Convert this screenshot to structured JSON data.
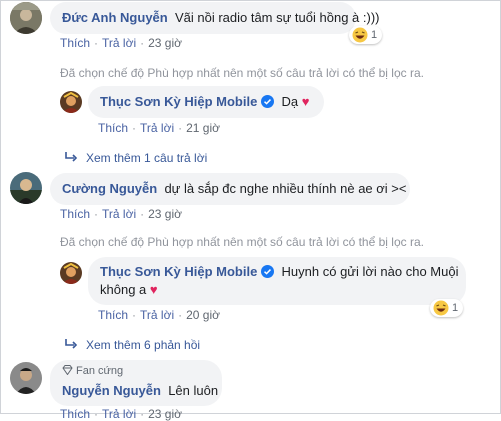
{
  "comments": [
    {
      "author": "Đức Anh Nguyễn",
      "text": "Vãi nồi radio tâm sự tuổi hồng à :)))",
      "actions": {
        "like": "Thích",
        "reply": "Trả lời",
        "time": "23 giờ"
      },
      "reaction": {
        "icon": "haha-emoji-icon",
        "count": "1"
      },
      "notice": "Đã chọn chế độ Phù hợp nhất nên một số câu trả lời có thể bị lọc ra.",
      "reply": {
        "author": "Thục Sơn Kỳ Hiệp Mobile",
        "text": "Dạ",
        "actions": {
          "like": "Thích",
          "reply": "Trả lời",
          "time": "21 giờ"
        }
      },
      "more_replies": "Xem thêm 1 câu trả lời"
    },
    {
      "author": "Cường Nguyễn",
      "text": "dự là sắp đc nghe nhiều thính nè ae ơi ><",
      "actions": {
        "like": "Thích",
        "reply": "Trả lời",
        "time": "23 giờ"
      },
      "notice": "Đã chọn chế độ Phù hợp nhất nên một số câu trả lời có thể bị lọc ra.",
      "reply": {
        "author": "Thục Sơn Kỳ Hiệp Mobile",
        "text_line1": "Huynh có gửi lời nào cho Muội",
        "text_line2": "không a",
        "actions": {
          "like": "Thích",
          "reply": "Trả lời",
          "time": "20 giờ"
        },
        "reaction": {
          "icon": "haha-emoji-icon",
          "count": "1"
        }
      },
      "more_replies": "Xem thêm 6 phản hồi"
    },
    {
      "badge": "Fan cứng",
      "author": "Nguyễn Nguyễn",
      "text": "Lên luôn",
      "actions": {
        "like": "Thích",
        "reply": "Trả lời",
        "time": "23 giờ"
      }
    }
  ],
  "colors": {
    "name": "#385898",
    "bubble": "#f2f3f5",
    "heart": "#e0245e",
    "verified": "#1877f2"
  }
}
